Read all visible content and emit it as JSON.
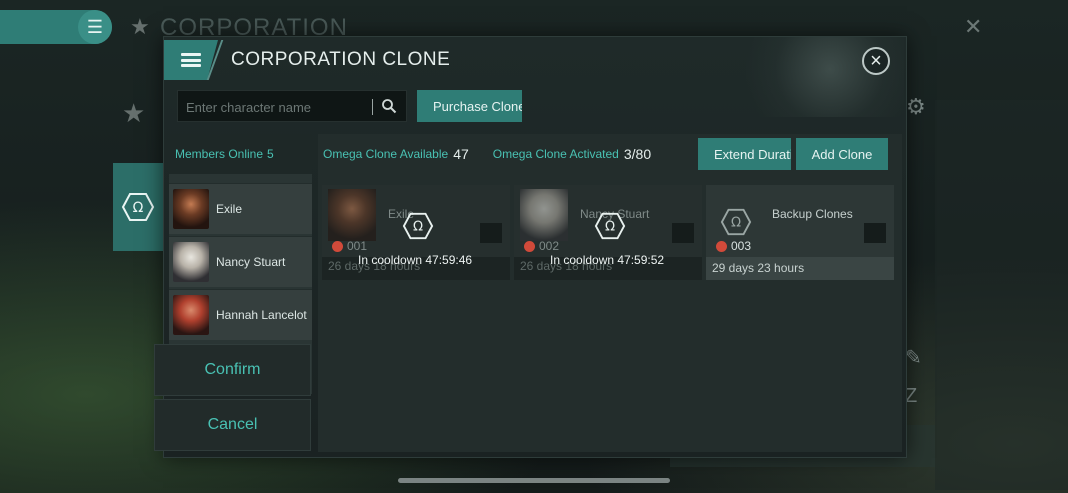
{
  "background": {
    "app_title": "CORPORATION"
  },
  "dialog": {
    "title": "CORPORATION CLONE",
    "search": {
      "placeholder": "Enter character name",
      "value": ""
    },
    "purchase_label": "Purchase Clone"
  },
  "members": {
    "label": "Members Online",
    "count": "5",
    "items": [
      {
        "name": "Exile"
      },
      {
        "name": "Nancy Stuart"
      },
      {
        "name": "Hannah Lancelot"
      }
    ]
  },
  "actions": {
    "confirm": "Confirm",
    "cancel": "Cancel"
  },
  "stats": {
    "omega_available_label": "Omega Clone Available",
    "omega_available_value": "47",
    "omega_activated_label": "Omega Clone Activated",
    "omega_activated_value": "3/80"
  },
  "buttons": {
    "extend": "Extend Duration",
    "add": "Add Clone"
  },
  "clones": [
    {
      "name": "Exile",
      "number": "001",
      "duration": "26 days 18 hours",
      "cooldown": "In cooldown 47:59:46"
    },
    {
      "name": "Nancy Stuart",
      "number": "002",
      "duration": "26 days 18 hours",
      "cooldown": "In cooldown 47:59:52"
    },
    {
      "name": "Backup Clones",
      "number": "003",
      "duration": "29 days 23 hours",
      "cooldown": ""
    }
  ],
  "colors": {
    "accent": "#2f7d76",
    "highlight_text": "#49c1b3",
    "badge": "#d14a3a"
  }
}
